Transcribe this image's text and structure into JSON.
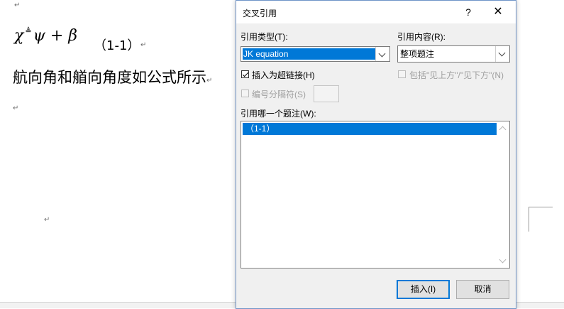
{
  "document": {
    "formula": {
      "chi": "χ",
      "defsym": "≜",
      "psi": "ψ",
      "plus": "+",
      "beta": "β"
    },
    "equation_number": "（1-1）",
    "body_text": "航向角和艏向角度如公式所示",
    "paragraph_mark": "↵"
  },
  "dialog": {
    "title": "交叉引用",
    "help_label": "?",
    "close_label": "✕",
    "reference_type_label": "引用类型(T):",
    "reference_type_value": "JK equation",
    "reference_content_label": "引用内容(R):",
    "reference_content_value": "整项题注",
    "insert_hyperlink_label": "插入为超链接(H)",
    "insert_hyperlink_checked": true,
    "include_above_below_label": "包括\"见上方\"/\"见下方\"(N)",
    "separate_numbers_label": "编号分隔符(S)",
    "which_caption_label": "引用哪一个题注(W):",
    "captions": [
      "（1-1）"
    ],
    "insert_button": "插入(I)",
    "cancel_button": "取消"
  }
}
